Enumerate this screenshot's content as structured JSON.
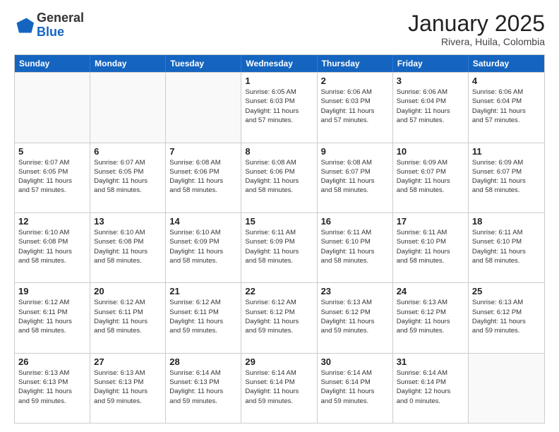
{
  "header": {
    "logo_general": "General",
    "logo_blue": "Blue",
    "month_title": "January 2025",
    "subtitle": "Rivera, Huila, Colombia"
  },
  "weekdays": [
    "Sunday",
    "Monday",
    "Tuesday",
    "Wednesday",
    "Thursday",
    "Friday",
    "Saturday"
  ],
  "rows": [
    [
      {
        "day": "",
        "info": ""
      },
      {
        "day": "",
        "info": ""
      },
      {
        "day": "",
        "info": ""
      },
      {
        "day": "1",
        "info": "Sunrise: 6:05 AM\nSunset: 6:03 PM\nDaylight: 11 hours\nand 57 minutes."
      },
      {
        "day": "2",
        "info": "Sunrise: 6:06 AM\nSunset: 6:03 PM\nDaylight: 11 hours\nand 57 minutes."
      },
      {
        "day": "3",
        "info": "Sunrise: 6:06 AM\nSunset: 6:04 PM\nDaylight: 11 hours\nand 57 minutes."
      },
      {
        "day": "4",
        "info": "Sunrise: 6:06 AM\nSunset: 6:04 PM\nDaylight: 11 hours\nand 57 minutes."
      }
    ],
    [
      {
        "day": "5",
        "info": "Sunrise: 6:07 AM\nSunset: 6:05 PM\nDaylight: 11 hours\nand 57 minutes."
      },
      {
        "day": "6",
        "info": "Sunrise: 6:07 AM\nSunset: 6:05 PM\nDaylight: 11 hours\nand 58 minutes."
      },
      {
        "day": "7",
        "info": "Sunrise: 6:08 AM\nSunset: 6:06 PM\nDaylight: 11 hours\nand 58 minutes."
      },
      {
        "day": "8",
        "info": "Sunrise: 6:08 AM\nSunset: 6:06 PM\nDaylight: 11 hours\nand 58 minutes."
      },
      {
        "day": "9",
        "info": "Sunrise: 6:08 AM\nSunset: 6:07 PM\nDaylight: 11 hours\nand 58 minutes."
      },
      {
        "day": "10",
        "info": "Sunrise: 6:09 AM\nSunset: 6:07 PM\nDaylight: 11 hours\nand 58 minutes."
      },
      {
        "day": "11",
        "info": "Sunrise: 6:09 AM\nSunset: 6:07 PM\nDaylight: 11 hours\nand 58 minutes."
      }
    ],
    [
      {
        "day": "12",
        "info": "Sunrise: 6:10 AM\nSunset: 6:08 PM\nDaylight: 11 hours\nand 58 minutes."
      },
      {
        "day": "13",
        "info": "Sunrise: 6:10 AM\nSunset: 6:08 PM\nDaylight: 11 hours\nand 58 minutes."
      },
      {
        "day": "14",
        "info": "Sunrise: 6:10 AM\nSunset: 6:09 PM\nDaylight: 11 hours\nand 58 minutes."
      },
      {
        "day": "15",
        "info": "Sunrise: 6:11 AM\nSunset: 6:09 PM\nDaylight: 11 hours\nand 58 minutes."
      },
      {
        "day": "16",
        "info": "Sunrise: 6:11 AM\nSunset: 6:10 PM\nDaylight: 11 hours\nand 58 minutes."
      },
      {
        "day": "17",
        "info": "Sunrise: 6:11 AM\nSunset: 6:10 PM\nDaylight: 11 hours\nand 58 minutes."
      },
      {
        "day": "18",
        "info": "Sunrise: 6:11 AM\nSunset: 6:10 PM\nDaylight: 11 hours\nand 58 minutes."
      }
    ],
    [
      {
        "day": "19",
        "info": "Sunrise: 6:12 AM\nSunset: 6:11 PM\nDaylight: 11 hours\nand 58 minutes."
      },
      {
        "day": "20",
        "info": "Sunrise: 6:12 AM\nSunset: 6:11 PM\nDaylight: 11 hours\nand 58 minutes."
      },
      {
        "day": "21",
        "info": "Sunrise: 6:12 AM\nSunset: 6:11 PM\nDaylight: 11 hours\nand 59 minutes."
      },
      {
        "day": "22",
        "info": "Sunrise: 6:12 AM\nSunset: 6:12 PM\nDaylight: 11 hours\nand 59 minutes."
      },
      {
        "day": "23",
        "info": "Sunrise: 6:13 AM\nSunset: 6:12 PM\nDaylight: 11 hours\nand 59 minutes."
      },
      {
        "day": "24",
        "info": "Sunrise: 6:13 AM\nSunset: 6:12 PM\nDaylight: 11 hours\nand 59 minutes."
      },
      {
        "day": "25",
        "info": "Sunrise: 6:13 AM\nSunset: 6:12 PM\nDaylight: 11 hours\nand 59 minutes."
      }
    ],
    [
      {
        "day": "26",
        "info": "Sunrise: 6:13 AM\nSunset: 6:13 PM\nDaylight: 11 hours\nand 59 minutes."
      },
      {
        "day": "27",
        "info": "Sunrise: 6:13 AM\nSunset: 6:13 PM\nDaylight: 11 hours\nand 59 minutes."
      },
      {
        "day": "28",
        "info": "Sunrise: 6:14 AM\nSunset: 6:13 PM\nDaylight: 11 hours\nand 59 minutes."
      },
      {
        "day": "29",
        "info": "Sunrise: 6:14 AM\nSunset: 6:14 PM\nDaylight: 11 hours\nand 59 minutes."
      },
      {
        "day": "30",
        "info": "Sunrise: 6:14 AM\nSunset: 6:14 PM\nDaylight: 11 hours\nand 59 minutes."
      },
      {
        "day": "31",
        "info": "Sunrise: 6:14 AM\nSunset: 6:14 PM\nDaylight: 12 hours\nand 0 minutes."
      },
      {
        "day": "",
        "info": ""
      }
    ]
  ]
}
